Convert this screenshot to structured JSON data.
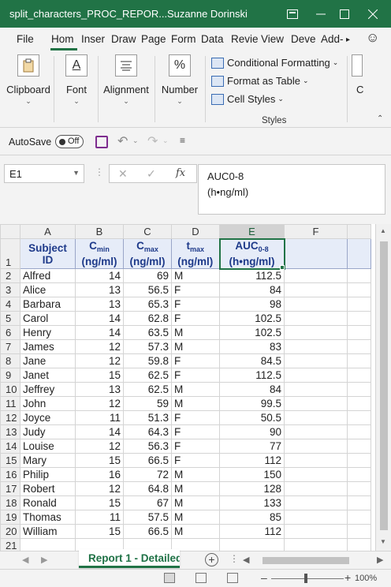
{
  "window": {
    "title": "split_characters_PROC_REPOR...",
    "user": "Suzanne Dorinski"
  },
  "ribbon_tabs": [
    "File",
    "Hom",
    "Inser",
    "Draw",
    "Page",
    "Form",
    "Data",
    "Revie",
    "View",
    "Deve",
    "Add-"
  ],
  "ribbon": {
    "clipboard": "Clipboard",
    "font": "Font",
    "alignment": "Alignment",
    "number": "Number",
    "number_icon": "%",
    "font_icon": "A",
    "conditional_formatting": "Conditional Formatting",
    "format_as_table": "Format as Table",
    "cell_styles": "Cell Styles",
    "styles_group": "Styles",
    "cells_group_partial": "C"
  },
  "qat": {
    "autosave": "AutoSave",
    "toggle": "Off"
  },
  "formula_bar": {
    "name_box": "E1",
    "fx": "fx",
    "content_line1": "AUC0-8",
    "content_line2": "(h•ng/ml)"
  },
  "columns": [
    "A",
    "B",
    "C",
    "D",
    "E",
    "F"
  ],
  "headers": {
    "A": [
      "Subject",
      "ID"
    ],
    "B": {
      "main": "C",
      "sub": "min",
      "unit": "(ng/ml)"
    },
    "C": {
      "main": "C",
      "sub": "max",
      "unit": "(ng/ml)"
    },
    "D": {
      "main": "t",
      "sub": "max",
      "unit": "(ng/ml)"
    },
    "E": {
      "main": "AUC",
      "sub": "0-8",
      "unit": "(h•ng/ml)"
    }
  },
  "rows": [
    [
      "Alfred",
      "14",
      "69",
      "M",
      "112.5"
    ],
    [
      "Alice",
      "13",
      "56.5",
      "F",
      "84"
    ],
    [
      "Barbara",
      "13",
      "65.3",
      "F",
      "98"
    ],
    [
      "Carol",
      "14",
      "62.8",
      "F",
      "102.5"
    ],
    [
      "Henry",
      "14",
      "63.5",
      "M",
      "102.5"
    ],
    [
      "James",
      "12",
      "57.3",
      "M",
      "83"
    ],
    [
      "Jane",
      "12",
      "59.8",
      "F",
      "84.5"
    ],
    [
      "Janet",
      "15",
      "62.5",
      "F",
      "112.5"
    ],
    [
      "Jeffrey",
      "13",
      "62.5",
      "M",
      "84"
    ],
    [
      "John",
      "12",
      "59",
      "M",
      "99.5"
    ],
    [
      "Joyce",
      "11",
      "51.3",
      "F",
      "50.5"
    ],
    [
      "Judy",
      "14",
      "64.3",
      "F",
      "90"
    ],
    [
      "Louise",
      "12",
      "56.3",
      "F",
      "77"
    ],
    [
      "Mary",
      "15",
      "66.5",
      "F",
      "112"
    ],
    [
      "Philip",
      "16",
      "72",
      "M",
      "150"
    ],
    [
      "Robert",
      "12",
      "64.8",
      "M",
      "128"
    ],
    [
      "Ronald",
      "15",
      "67",
      "M",
      "133"
    ],
    [
      "Thomas",
      "11",
      "57.5",
      "M",
      "85"
    ],
    [
      "William",
      "15",
      "66.5",
      "M",
      "112"
    ]
  ],
  "sheet": {
    "active_tab": "Report 1 - Detailed"
  },
  "status": {
    "zoom": "100%"
  }
}
